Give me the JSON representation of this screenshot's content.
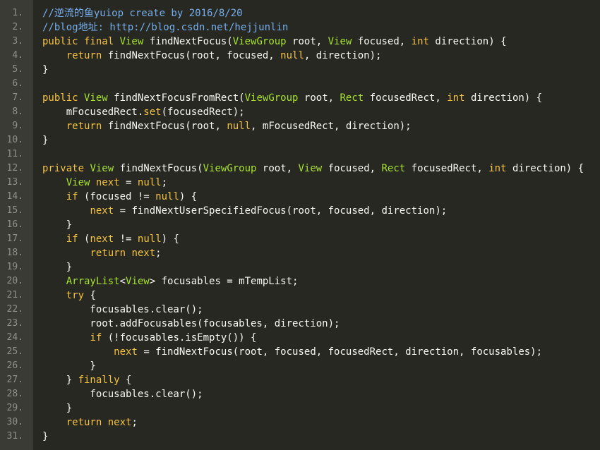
{
  "editor": {
    "lines": [
      {
        "num": "1.",
        "segs": [
          {
            "cls": "c",
            "text": "//逆流的鱼yuiop create by 2016/8/20"
          }
        ]
      },
      {
        "num": "2.",
        "segs": [
          {
            "cls": "c",
            "text": "//blog地址: http://blog.csdn.net/hejjunlin"
          }
        ]
      },
      {
        "num": "3.",
        "segs": [
          {
            "cls": "k",
            "text": "public final "
          },
          {
            "cls": "t",
            "text": "View "
          },
          {
            "cls": "p",
            "text": "findNextFocus("
          },
          {
            "cls": "t",
            "text": "ViewGroup "
          },
          {
            "cls": "p",
            "text": "root, "
          },
          {
            "cls": "t",
            "text": "View "
          },
          {
            "cls": "p",
            "text": "focused, "
          },
          {
            "cls": "k",
            "text": "int "
          },
          {
            "cls": "p",
            "text": "direction) {"
          }
        ]
      },
      {
        "num": "4.",
        "segs": [
          {
            "cls": "p",
            "text": "    "
          },
          {
            "cls": "k",
            "text": "return "
          },
          {
            "cls": "p",
            "text": "findNextFocus(root, focused, "
          },
          {
            "cls": "n",
            "text": "null"
          },
          {
            "cls": "p",
            "text": ", direction);"
          }
        ]
      },
      {
        "num": "5.",
        "segs": [
          {
            "cls": "p",
            "text": "}"
          }
        ]
      },
      {
        "num": "6.",
        "segs": []
      },
      {
        "num": "7.",
        "segs": [
          {
            "cls": "k",
            "text": "public "
          },
          {
            "cls": "t",
            "text": "View "
          },
          {
            "cls": "p",
            "text": "findNextFocusFromRect("
          },
          {
            "cls": "t",
            "text": "ViewGroup "
          },
          {
            "cls": "p",
            "text": "root, "
          },
          {
            "cls": "t",
            "text": "Rect "
          },
          {
            "cls": "p",
            "text": "focusedRect, "
          },
          {
            "cls": "k",
            "text": "int "
          },
          {
            "cls": "p",
            "text": "direction) {"
          }
        ]
      },
      {
        "num": "8.",
        "segs": [
          {
            "cls": "p",
            "text": "    mFocusedRect."
          },
          {
            "cls": "k",
            "text": "set"
          },
          {
            "cls": "p",
            "text": "(focusedRect);"
          }
        ]
      },
      {
        "num": "9.",
        "segs": [
          {
            "cls": "p",
            "text": "    "
          },
          {
            "cls": "k",
            "text": "return "
          },
          {
            "cls": "p",
            "text": "findNextFocus(root, "
          },
          {
            "cls": "n",
            "text": "null"
          },
          {
            "cls": "p",
            "text": ", mFocusedRect, direction);"
          }
        ]
      },
      {
        "num": "10.",
        "segs": [
          {
            "cls": "p",
            "text": "}"
          }
        ]
      },
      {
        "num": "11.",
        "segs": []
      },
      {
        "num": "12.",
        "segs": [
          {
            "cls": "k",
            "text": "private "
          },
          {
            "cls": "t",
            "text": "View "
          },
          {
            "cls": "p",
            "text": "findNextFocus("
          },
          {
            "cls": "t",
            "text": "ViewGroup "
          },
          {
            "cls": "p",
            "text": "root, "
          },
          {
            "cls": "t",
            "text": "View "
          },
          {
            "cls": "p",
            "text": "focused, "
          },
          {
            "cls": "t",
            "text": "Rect "
          },
          {
            "cls": "p",
            "text": "focusedRect, "
          },
          {
            "cls": "k",
            "text": "int "
          },
          {
            "cls": "p",
            "text": "direction) {"
          }
        ]
      },
      {
        "num": "13.",
        "segs": [
          {
            "cls": "p",
            "text": "    "
          },
          {
            "cls": "t",
            "text": "View "
          },
          {
            "cls": "k",
            "text": "next "
          },
          {
            "cls": "p",
            "text": "= "
          },
          {
            "cls": "n",
            "text": "null"
          },
          {
            "cls": "p",
            "text": ";"
          }
        ]
      },
      {
        "num": "14.",
        "segs": [
          {
            "cls": "p",
            "text": "    "
          },
          {
            "cls": "k",
            "text": "if "
          },
          {
            "cls": "p",
            "text": "(focused != "
          },
          {
            "cls": "n",
            "text": "null"
          },
          {
            "cls": "p",
            "text": ") {"
          }
        ]
      },
      {
        "num": "15.",
        "segs": [
          {
            "cls": "p",
            "text": "        "
          },
          {
            "cls": "k",
            "text": "next "
          },
          {
            "cls": "p",
            "text": "= findNextUserSpecifiedFocus(root, focused, direction);"
          }
        ]
      },
      {
        "num": "16.",
        "segs": [
          {
            "cls": "p",
            "text": "    }"
          }
        ]
      },
      {
        "num": "17.",
        "segs": [
          {
            "cls": "p",
            "text": "    "
          },
          {
            "cls": "k",
            "text": "if "
          },
          {
            "cls": "p",
            "text": "("
          },
          {
            "cls": "k",
            "text": "next "
          },
          {
            "cls": "p",
            "text": "!= "
          },
          {
            "cls": "n",
            "text": "null"
          },
          {
            "cls": "p",
            "text": ") {"
          }
        ]
      },
      {
        "num": "18.",
        "segs": [
          {
            "cls": "p",
            "text": "        "
          },
          {
            "cls": "k",
            "text": "return next"
          },
          {
            "cls": "p",
            "text": ";"
          }
        ]
      },
      {
        "num": "19.",
        "segs": [
          {
            "cls": "p",
            "text": "    }"
          }
        ]
      },
      {
        "num": "20.",
        "segs": [
          {
            "cls": "p",
            "text": "    "
          },
          {
            "cls": "t",
            "text": "ArrayList"
          },
          {
            "cls": "p",
            "text": "<"
          },
          {
            "cls": "t",
            "text": "View"
          },
          {
            "cls": "p",
            "text": "> focusables = mTempList;"
          }
        ]
      },
      {
        "num": "21.",
        "segs": [
          {
            "cls": "p",
            "text": "    "
          },
          {
            "cls": "k",
            "text": "try "
          },
          {
            "cls": "p",
            "text": "{"
          }
        ]
      },
      {
        "num": "22.",
        "segs": [
          {
            "cls": "p",
            "text": "        focusables.clear();"
          }
        ]
      },
      {
        "num": "23.",
        "segs": [
          {
            "cls": "p",
            "text": "        root.addFocusables(focusables, direction);"
          }
        ]
      },
      {
        "num": "24.",
        "segs": [
          {
            "cls": "p",
            "text": "        "
          },
          {
            "cls": "k",
            "text": "if "
          },
          {
            "cls": "p",
            "text": "(!focusables.isEmpty()) {"
          }
        ]
      },
      {
        "num": "25.",
        "segs": [
          {
            "cls": "p",
            "text": "            "
          },
          {
            "cls": "k",
            "text": "next "
          },
          {
            "cls": "p",
            "text": "= findNextFocus(root, focused, focusedRect, direction, focusables);"
          }
        ]
      },
      {
        "num": "26.",
        "segs": [
          {
            "cls": "p",
            "text": "        }"
          }
        ]
      },
      {
        "num": "27.",
        "segs": [
          {
            "cls": "p",
            "text": "    } "
          },
          {
            "cls": "k",
            "text": "finally "
          },
          {
            "cls": "p",
            "text": "{"
          }
        ]
      },
      {
        "num": "28.",
        "segs": [
          {
            "cls": "p",
            "text": "        focusables.clear();"
          }
        ]
      },
      {
        "num": "29.",
        "segs": [
          {
            "cls": "p",
            "text": "    }"
          }
        ]
      },
      {
        "num": "30.",
        "segs": [
          {
            "cls": "p",
            "text": "    "
          },
          {
            "cls": "k",
            "text": "return next"
          },
          {
            "cls": "p",
            "text": ";"
          }
        ]
      },
      {
        "num": "31.",
        "segs": [
          {
            "cls": "p",
            "text": "}"
          }
        ]
      }
    ]
  },
  "colors": {
    "background": "#272822",
    "gutter": "#3a3b35",
    "comment": "#75aeee",
    "keyword": "#f5c242",
    "type": "#a6e22e",
    "plain": "#f8f8f2",
    "line_number": "#8f908a"
  }
}
